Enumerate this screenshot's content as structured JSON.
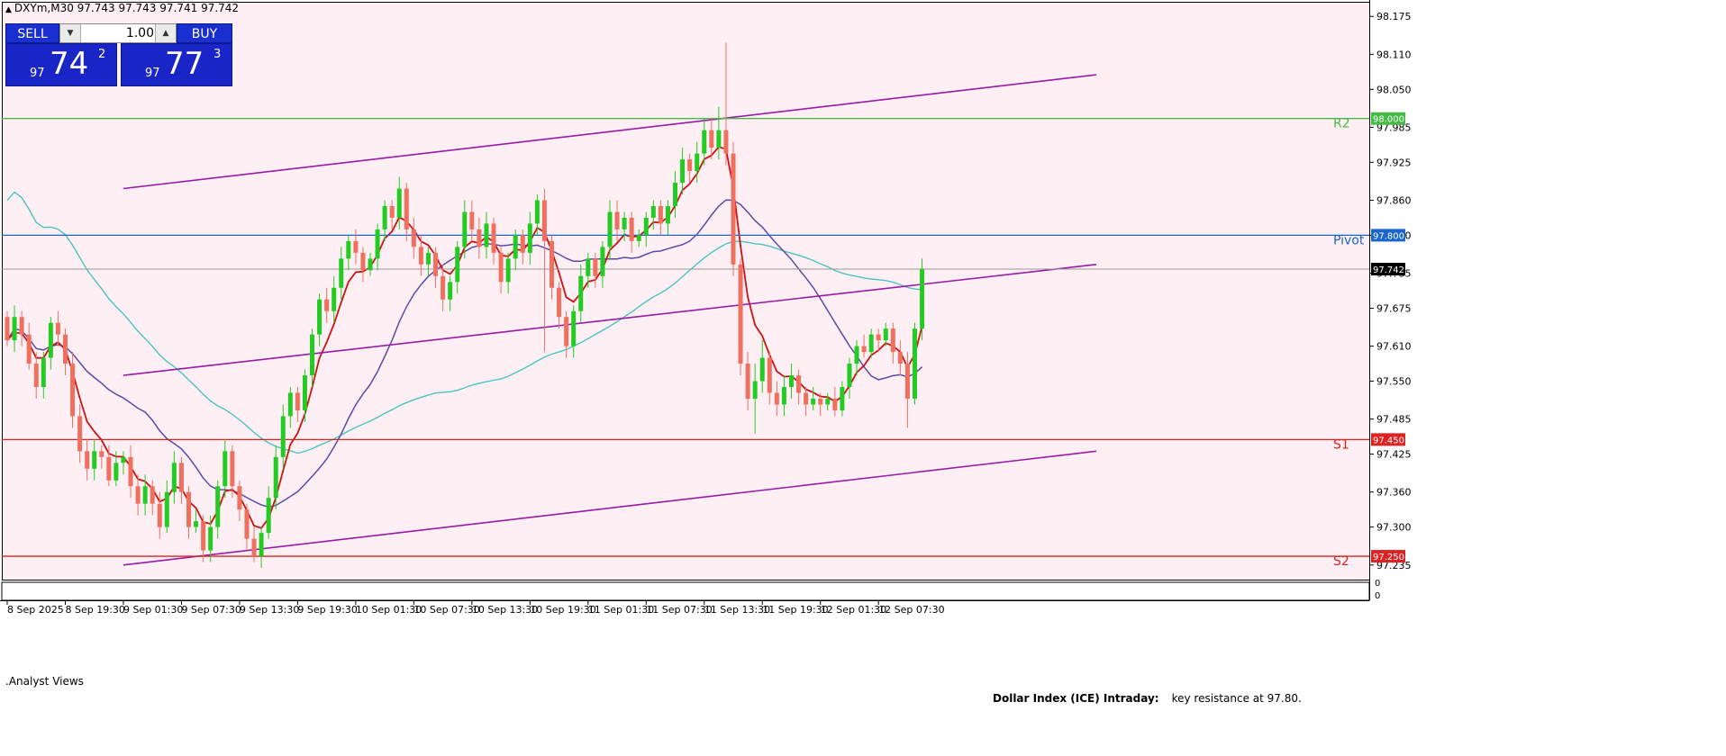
{
  "header": {
    "symbol_text": "DXYm,M30  97.743 97.743 97.741 97.742"
  },
  "trade_panel": {
    "sell_label": "SELL",
    "buy_label": "BUY",
    "lot_value": "1.00",
    "sell_quote": {
      "prefix": "97",
      "big": "74",
      "sup": "2"
    },
    "buy_quote": {
      "prefix": "97",
      "big": "77",
      "sup": "3"
    },
    "button_color": "#1a25c8"
  },
  "colors": {
    "background": "#fdeff4",
    "bull_candle": "#22cc22",
    "bear_candle": "#f07060",
    "ema_fast": "#cc1111",
    "ma_mid": "#5a4aaa",
    "ma_slow": "#4cc4c0",
    "channel": "#9a1aa8",
    "pivot": "#1a66cc",
    "resistance": "#44bb44",
    "support": "#dd2222"
  },
  "chart_data": {
    "type": "candlestick",
    "instrument": "DXYm",
    "timeframe": "M30",
    "ylim": [
      97.21,
      98.2
    ],
    "y_ticks": [
      "98.175",
      "98.110",
      "98.050",
      "97.985",
      "97.925",
      "97.860",
      "97.800",
      "97.735",
      "97.675",
      "97.610",
      "97.550",
      "97.485",
      "97.425",
      "97.360",
      "97.300",
      "97.235"
    ],
    "x_ticks": [
      "8 Sep 2025",
      "8 Sep 19:30",
      "9 Sep 01:30",
      "9 Sep 07:30",
      "9 Sep 13:30",
      "9 Sep 19:30",
      "10 Sep 01:30",
      "10 Sep 07:30",
      "10 Sep 13:30",
      "10 Sep 19:30",
      "11 Sep 01:30",
      "11 Sep 07:30",
      "11 Sep 13:30",
      "11 Sep 19:30",
      "12 Sep 01:30",
      "12 Sep 07:30"
    ],
    "current_price": "97.742",
    "levels": [
      {
        "name": "R2",
        "value": 98.0,
        "label": "98.000",
        "color": "#44bb44"
      },
      {
        "name": "Pivot",
        "value": 97.8,
        "label": "97.800",
        "color": "#1a66cc"
      },
      {
        "name": "S1",
        "value": 97.45,
        "label": "97.450",
        "color": "#dd2222"
      },
      {
        "name": "S2",
        "value": 97.25,
        "label": "97.250",
        "color": "#dd2222"
      }
    ],
    "channel": [
      {
        "name": "upper",
        "x": [
          16,
          150
        ],
        "y": [
          97.88,
          98.075
        ]
      },
      {
        "name": "middle",
        "x": [
          16,
          150
        ],
        "y": [
          97.56,
          97.75
        ]
      },
      {
        "name": "lower",
        "x": [
          16,
          150
        ],
        "y": [
          97.235,
          97.43
        ]
      }
    ],
    "candles": [
      [
        97.66,
        97.62,
        97.67,
        97.61
      ],
      [
        97.62,
        97.66,
        97.68,
        97.6
      ],
      [
        97.66,
        97.63,
        97.67,
        97.61
      ],
      [
        97.63,
        97.58,
        97.65,
        97.57
      ],
      [
        97.58,
        97.54,
        97.6,
        97.52
      ],
      [
        97.54,
        97.59,
        97.6,
        97.52
      ],
      [
        97.59,
        97.65,
        97.66,
        97.57
      ],
      [
        97.65,
        97.63,
        97.67,
        97.61
      ],
      [
        97.63,
        97.58,
        97.64,
        97.56
      ],
      [
        97.58,
        97.49,
        97.6,
        97.47
      ],
      [
        97.49,
        97.43,
        97.51,
        97.41
      ],
      [
        97.43,
        97.4,
        97.45,
        97.38
      ],
      [
        97.4,
        97.43,
        97.45,
        97.38
      ],
      [
        97.43,
        97.42,
        97.44,
        97.4
      ],
      [
        97.42,
        97.38,
        97.44,
        97.37
      ],
      [
        97.38,
        97.41,
        97.43,
        97.37
      ],
      [
        97.41,
        97.42,
        97.43,
        97.39
      ],
      [
        97.42,
        97.37,
        97.44,
        97.35
      ],
      [
        97.37,
        97.34,
        97.39,
        97.32
      ],
      [
        97.34,
        97.37,
        97.39,
        97.32
      ],
      [
        97.37,
        97.34,
        97.38,
        97.32
      ],
      [
        97.34,
        97.3,
        97.36,
        97.28
      ],
      [
        97.3,
        97.36,
        97.38,
        97.29
      ],
      [
        97.36,
        97.41,
        97.43,
        97.34
      ],
      [
        97.41,
        97.36,
        97.42,
        97.34
      ],
      [
        97.36,
        97.3,
        97.37,
        97.28
      ],
      [
        97.3,
        97.31,
        97.33,
        97.29
      ],
      [
        97.31,
        97.26,
        97.32,
        97.24
      ],
      [
        97.26,
        97.3,
        97.32,
        97.24
      ],
      [
        97.3,
        97.37,
        97.38,
        97.28
      ],
      [
        97.37,
        97.43,
        97.45,
        97.35
      ],
      [
        97.43,
        97.37,
        97.44,
        97.35
      ],
      [
        97.37,
        97.33,
        97.38,
        97.31
      ],
      [
        97.33,
        97.28,
        97.34,
        97.26
      ],
      [
        97.28,
        97.25,
        97.3,
        97.24
      ],
      [
        97.25,
        97.29,
        97.3,
        97.23
      ],
      [
        97.29,
        97.35,
        97.37,
        97.28
      ],
      [
        97.35,
        97.42,
        97.44,
        97.33
      ],
      [
        97.42,
        97.49,
        97.51,
        97.4
      ],
      [
        97.49,
        97.53,
        97.54,
        97.47
      ],
      [
        97.53,
        97.5,
        97.54,
        97.48
      ],
      [
        97.5,
        97.56,
        97.57,
        97.48
      ],
      [
        97.56,
        97.63,
        97.64,
        97.54
      ],
      [
        97.63,
        97.69,
        97.7,
        97.61
      ],
      [
        97.69,
        97.67,
        97.71,
        97.65
      ],
      [
        97.67,
        97.71,
        97.73,
        97.65
      ],
      [
        97.71,
        97.76,
        97.78,
        97.69
      ],
      [
        97.76,
        97.79,
        97.8,
        97.74
      ],
      [
        97.79,
        97.77,
        97.81,
        97.75
      ],
      [
        97.77,
        97.74,
        97.78,
        97.72
      ],
      [
        97.74,
        97.76,
        97.77,
        97.73
      ],
      [
        97.76,
        97.81,
        97.82,
        97.74
      ],
      [
        97.81,
        97.85,
        97.86,
        97.79
      ],
      [
        97.85,
        97.83,
        97.86,
        97.81
      ],
      [
        97.83,
        97.88,
        97.9,
        97.81
      ],
      [
        97.88,
        97.81,
        97.89,
        97.79
      ],
      [
        97.81,
        97.78,
        97.83,
        97.76
      ],
      [
        97.78,
        97.75,
        97.8,
        97.73
      ],
      [
        97.75,
        97.77,
        97.78,
        97.73
      ],
      [
        97.77,
        97.73,
        97.78,
        97.71
      ],
      [
        97.73,
        97.69,
        97.75,
        97.67
      ],
      [
        97.69,
        97.72,
        97.73,
        97.67
      ],
      [
        97.72,
        97.78,
        97.79,
        97.7
      ],
      [
        97.78,
        97.84,
        97.86,
        97.76
      ],
      [
        97.84,
        97.81,
        97.86,
        97.79
      ],
      [
        97.81,
        97.78,
        97.83,
        97.76
      ],
      [
        97.78,
        97.82,
        97.84,
        97.76
      ],
      [
        97.82,
        97.77,
        97.83,
        97.75
      ],
      [
        97.77,
        97.72,
        97.78,
        97.7
      ],
      [
        97.72,
        97.76,
        97.77,
        97.7
      ],
      [
        97.76,
        97.8,
        97.81,
        97.74
      ],
      [
        97.8,
        97.77,
        97.81,
        97.75
      ],
      [
        97.77,
        97.82,
        97.84,
        97.75
      ],
      [
        97.82,
        97.86,
        97.87,
        97.8
      ],
      [
        97.86,
        97.79,
        97.88,
        97.6
      ],
      [
        97.79,
        97.71,
        97.8,
        97.69
      ],
      [
        97.71,
        97.66,
        97.72,
        97.64
      ],
      [
        97.66,
        97.61,
        97.67,
        97.59
      ],
      [
        97.61,
        97.67,
        97.68,
        97.59
      ],
      [
        97.67,
        97.73,
        97.75,
        97.65
      ],
      [
        97.73,
        97.76,
        97.77,
        97.71
      ],
      [
        97.76,
        97.73,
        97.77,
        97.71
      ],
      [
        97.73,
        97.78,
        97.79,
        97.71
      ],
      [
        97.78,
        97.84,
        97.86,
        97.76
      ],
      [
        97.84,
        97.81,
        97.86,
        97.79
      ],
      [
        97.81,
        97.83,
        97.84,
        97.79
      ],
      [
        97.83,
        97.79,
        97.84,
        97.77
      ],
      [
        97.79,
        97.8,
        97.81,
        97.78
      ],
      [
        97.8,
        97.83,
        97.84,
        97.78
      ],
      [
        97.83,
        97.85,
        97.86,
        97.81
      ],
      [
        97.85,
        97.82,
        97.86,
        97.8
      ],
      [
        97.82,
        97.85,
        97.86,
        97.8
      ],
      [
        97.85,
        97.89,
        97.91,
        97.83
      ],
      [
        97.89,
        97.93,
        97.95,
        97.87
      ],
      [
        97.93,
        97.91,
        97.94,
        97.89
      ],
      [
        97.91,
        97.94,
        97.96,
        97.89
      ],
      [
        97.94,
        97.98,
        98.0,
        97.92
      ],
      [
        97.98,
        97.95,
        98.0,
        97.93
      ],
      [
        97.95,
        97.98,
        98.02,
        97.93
      ],
      [
        97.98,
        97.94,
        98.13,
        97.92
      ],
      [
        97.94,
        97.75,
        97.96,
        97.73
      ],
      [
        97.75,
        97.58,
        97.76,
        97.56
      ],
      [
        97.58,
        97.52,
        97.6,
        97.5
      ],
      [
        97.52,
        97.55,
        97.58,
        97.46
      ],
      [
        97.55,
        97.59,
        97.62,
        97.53
      ],
      [
        97.59,
        97.53,
        97.6,
        97.51
      ],
      [
        97.53,
        97.51,
        97.55,
        97.49
      ],
      [
        97.51,
        97.54,
        97.56,
        97.49
      ],
      [
        97.54,
        97.56,
        97.58,
        97.52
      ],
      [
        97.56,
        97.53,
        97.57,
        97.51
      ],
      [
        97.53,
        97.51,
        97.54,
        97.49
      ],
      [
        97.51,
        97.52,
        97.54,
        97.5
      ],
      [
        97.52,
        97.51,
        97.53,
        97.49
      ],
      [
        97.51,
        97.52,
        97.53,
        97.5
      ],
      [
        97.52,
        97.5,
        97.54,
        97.49
      ],
      [
        97.5,
        97.54,
        97.55,
        97.49
      ],
      [
        97.54,
        97.58,
        97.59,
        97.52
      ],
      [
        97.58,
        97.61,
        97.62,
        97.56
      ],
      [
        97.61,
        97.6,
        97.63,
        97.59
      ],
      [
        97.6,
        97.63,
        97.64,
        97.59
      ],
      [
        97.63,
        97.62,
        97.64,
        97.6
      ],
      [
        97.62,
        97.64,
        97.65,
        97.61
      ],
      [
        97.64,
        97.6,
        97.65,
        97.58
      ],
      [
        97.6,
        97.58,
        97.62,
        97.56
      ],
      [
        97.58,
        97.52,
        97.6,
        97.47
      ],
      [
        97.52,
        97.64,
        97.65,
        97.51
      ],
      [
        97.64,
        97.742,
        97.76,
        97.62
      ]
    ]
  },
  "bottom_panel": {
    "label": ".Analyst Views",
    "annotation_title": "Dollar Index (ICE) Intraday:",
    "annotation_text": "key resistance at 97.80."
  }
}
